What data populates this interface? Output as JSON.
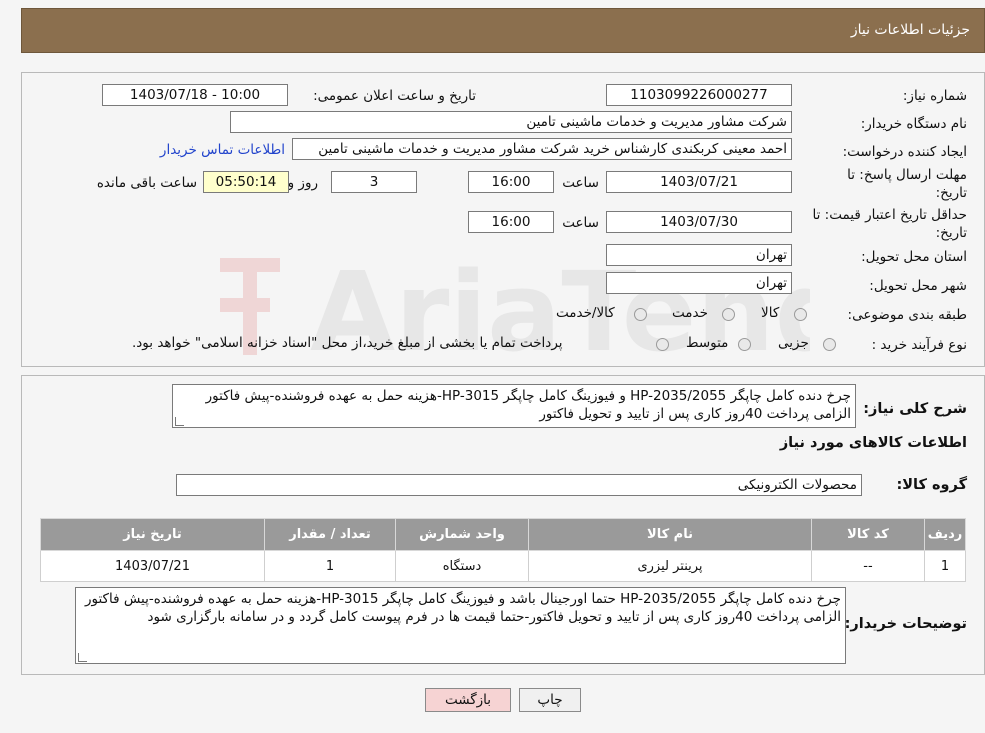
{
  "header": {
    "title": "جزئیات اطلاعات نیاز"
  },
  "form": {
    "need_number_label": "شماره نیاز:",
    "need_number": "1103099226000277",
    "announce_label": "تاریخ و ساعت اعلان عمومی:",
    "announce_value": "1403/07/18 - 10:00",
    "buyer_label": "نام دستگاه خریدار:",
    "buyer_value": "شرکت مشاور مدیریت و خدمات ماشینی تامین",
    "creator_label": "ایجاد کننده درخواست:",
    "creator_value": "احمد معینی کربکندی کارشناس خرید شرکت مشاور مدیریت و خدمات ماشینی تامین",
    "contact_link": "اطلاعات تماس خریدار",
    "deadline_label": "مهلت ارسال پاسخ: تا تاریخ:",
    "deadline_date": "1403/07/21",
    "time_label": "ساعت",
    "deadline_time": "16:00",
    "days_value": "3",
    "days_label": "روز و",
    "remaining_value": "05:50:14",
    "remaining_label": "ساعت باقی مانده",
    "validity_label": "حداقل تاریخ اعتبار قیمت: تا تاریخ:",
    "validity_date": "1403/07/30",
    "validity_time": "16:00",
    "province_label": "استان محل تحویل:",
    "province_value": "تهران",
    "city_label": "شهر محل تحویل:",
    "city_value": "تهران",
    "category_label": "طبقه بندی موضوعی:",
    "category_options": [
      "کالا",
      "خدمت",
      "کالا/خدمت"
    ],
    "process_label": "نوع فرآیند خرید :",
    "process_options": [
      "جزیی",
      "متوسط"
    ],
    "process_note": "پرداخت تمام یا بخشی از مبلغ خرید،از محل \"اسناد خزانه اسلامی\" خواهد بود."
  },
  "summary": {
    "label": "شرح کلی نیاز:",
    "text": "چرخ دنده کامل چاپگر HP-2035/2055 و فیوزینگ کامل چاپگر HP-3015-هزینه حمل به عهده فروشنده-پیش فاکتور الزامی پرداخت 40روز کاری پس از تایید و تحویل فاکتور"
  },
  "goods": {
    "section_title": "اطلاعات کالاهای مورد نیاز",
    "group_label": "گروه کالا:",
    "group_value": "محصولات الکترونیکی",
    "columns": [
      "ردیف",
      "کد کالا",
      "نام کالا",
      "واحد شمارش",
      "تعداد / مقدار",
      "تاریخ نیاز"
    ],
    "rows": [
      [
        "1",
        "--",
        "پرینتر لیزری",
        "دستگاه",
        "1",
        "1403/07/21"
      ]
    ]
  },
  "buyer_notes": {
    "label": "توضیحات خریدار:",
    "text": "چرخ دنده کامل چاپگر HP-2035/2055 حتما اورجینال باشد و فیوزینگ کامل چاپگر HP-3015-هزینه حمل به عهده فروشنده-پیش فاکتور الزامی پرداخت 40روز کاری پس از تایید و تحویل فاکتور-حتما قیمت ها در فرم پیوست کامل گردد و در سامانه بارگزاری شود"
  },
  "buttons": {
    "print": "چاپ",
    "back": "بازگشت"
  },
  "colors": {
    "header": "#8b6f4e",
    "table_header": "#9a9a9a",
    "back_button": "#f6d3d3",
    "remaining_bg": "#ffffcc",
    "link": "#2244cc"
  }
}
